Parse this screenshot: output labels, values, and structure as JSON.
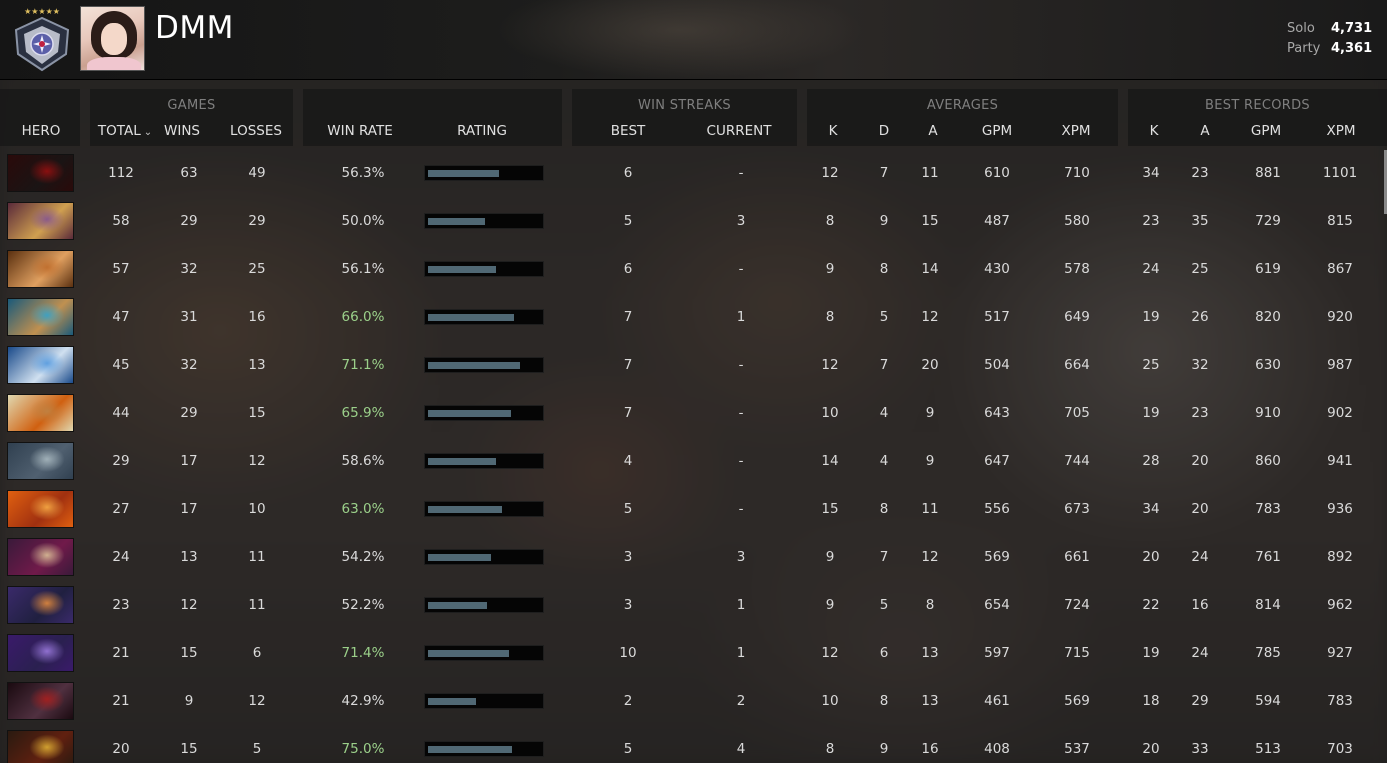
{
  "player": {
    "name": "DMM",
    "rank_medal": "medal-icon",
    "stars": "★★★★★"
  },
  "mmr": {
    "solo_label": "Solo",
    "solo_value": "4,731",
    "party_label": "Party",
    "party_value": "4,361"
  },
  "groups": {
    "games": "GAMES",
    "win_streaks": "WIN STREAKS",
    "averages": "AVERAGES",
    "best_records": "BEST RECORDS"
  },
  "columns": {
    "hero": "HERO",
    "total": "TOTAL",
    "wins": "WINS",
    "losses": "LOSSES",
    "win_rate": "WIN RATE",
    "rating": "RATING",
    "best": "BEST",
    "current": "CURRENT",
    "avg_k": "K",
    "avg_d": "D",
    "avg_a": "A",
    "avg_gpm": "GPM",
    "avg_xpm": "XPM",
    "rec_k": "K",
    "rec_a": "A",
    "rec_gpm": "GPM",
    "rec_xpm": "XPM"
  },
  "colors": {
    "win_rate_high": "#9bd08a",
    "rating_bar": "#506874"
  },
  "rows": [
    {
      "hero_icon": "shadow-fiend-icon",
      "hero_colors": [
        "#2a0a0a",
        "#8a1010",
        "#1a1414"
      ],
      "total": "112",
      "wins": "63",
      "losses": "49",
      "win_rate": "56.3%",
      "high": false,
      "rating": 0.62,
      "best": "6",
      "current": "-",
      "k": "12",
      "d": "7",
      "a": "11",
      "gpm": "610",
      "xpm": "710",
      "rk": "34",
      "ra": "23",
      "rgpm": "881",
      "rxpm": "1101"
    },
    {
      "hero_icon": "troll-warlord-icon",
      "hero_colors": [
        "#5a2a3a",
        "#8a5a8a",
        "#d0a050"
      ],
      "total": "58",
      "wins": "29",
      "losses": "29",
      "win_rate": "50.0%",
      "high": false,
      "rating": 0.5,
      "best": "5",
      "current": "3",
      "k": "8",
      "d": "9",
      "a": "15",
      "gpm": "487",
      "xpm": "580",
      "rk": "23",
      "ra": "35",
      "rgpm": "729",
      "rxpm": "815"
    },
    {
      "hero_icon": "brewmaster-icon",
      "hero_colors": [
        "#5a3010",
        "#c07030",
        "#e0a060"
      ],
      "total": "57",
      "wins": "32",
      "losses": "25",
      "win_rate": "56.1%",
      "high": false,
      "rating": 0.6,
      "best": "6",
      "current": "-",
      "k": "9",
      "d": "8",
      "a": "14",
      "gpm": "430",
      "xpm": "578",
      "rk": "24",
      "ra": "25",
      "rgpm": "619",
      "rxpm": "867"
    },
    {
      "hero_icon": "sniper-icon",
      "hero_colors": [
        "#1a5a7a",
        "#40a0c0",
        "#c09050"
      ],
      "total": "47",
      "wins": "31",
      "losses": "16",
      "win_rate": "66.0%",
      "high": true,
      "rating": 0.75,
      "best": "7",
      "current": "1",
      "k": "8",
      "d": "5",
      "a": "12",
      "gpm": "517",
      "xpm": "649",
      "rk": "19",
      "ra": "26",
      "rgpm": "820",
      "rxpm": "920"
    },
    {
      "hero_icon": "zeus-icon",
      "hero_colors": [
        "#1a4a8a",
        "#60a0e0",
        "#d0e0f0"
      ],
      "total": "45",
      "wins": "32",
      "losses": "13",
      "win_rate": "71.1%",
      "high": true,
      "rating": 0.81,
      "best": "7",
      "current": "-",
      "k": "12",
      "d": "7",
      "a": "20",
      "gpm": "504",
      "xpm": "664",
      "rk": "25",
      "ra": "32",
      "rgpm": "630",
      "rxpm": "987"
    },
    {
      "hero_icon": "mars-icon",
      "hero_colors": [
        "#e0d8b0",
        "#c08040",
        "#d06010"
      ],
      "total": "44",
      "wins": "29",
      "losses": "15",
      "win_rate": "65.9%",
      "high": true,
      "rating": 0.73,
      "best": "7",
      "current": "-",
      "k": "10",
      "d": "4",
      "a": "9",
      "gpm": "643",
      "xpm": "705",
      "rk": "19",
      "ra": "23",
      "rgpm": "910",
      "rxpm": "902"
    },
    {
      "hero_icon": "lancer-icon",
      "hero_colors": [
        "#304050",
        "#a0b0b8",
        "#506070"
      ],
      "total": "29",
      "wins": "17",
      "losses": "12",
      "win_rate": "58.6%",
      "high": false,
      "rating": 0.6,
      "best": "4",
      "current": "-",
      "k": "14",
      "d": "4",
      "a": "9",
      "gpm": "647",
      "xpm": "744",
      "rk": "28",
      "ra": "20",
      "rgpm": "860",
      "rxpm": "941"
    },
    {
      "hero_icon": "lina-icon",
      "hero_colors": [
        "#e06010",
        "#f0a040",
        "#a03010"
      ],
      "total": "27",
      "wins": "17",
      "losses": "10",
      "win_rate": "63.0%",
      "high": true,
      "rating": 0.65,
      "best": "5",
      "current": "-",
      "k": "15",
      "d": "8",
      "a": "11",
      "gpm": "556",
      "xpm": "673",
      "rk": "34",
      "ra": "20",
      "rgpm": "783",
      "rxpm": "936"
    },
    {
      "hero_icon": "invoker-icon",
      "hero_colors": [
        "#3a1a3a",
        "#d0b090",
        "#701a4a"
      ],
      "total": "24",
      "wins": "13",
      "losses": "11",
      "win_rate": "54.2%",
      "high": false,
      "rating": 0.55,
      "best": "3",
      "current": "3",
      "k": "9",
      "d": "7",
      "a": "12",
      "gpm": "569",
      "xpm": "661",
      "rk": "20",
      "ra": "24",
      "rgpm": "761",
      "rxpm": "892"
    },
    {
      "hero_icon": "anti-mage-icon",
      "hero_colors": [
        "#3a2a6a",
        "#d08040",
        "#202040"
      ],
      "total": "23",
      "wins": "12",
      "losses": "11",
      "win_rate": "52.2%",
      "high": false,
      "rating": 0.52,
      "best": "3",
      "current": "1",
      "k": "9",
      "d": "5",
      "a": "8",
      "gpm": "654",
      "xpm": "724",
      "rk": "22",
      "ra": "16",
      "rgpm": "814",
      "rxpm": "962"
    },
    {
      "hero_icon": "faceless-void-icon",
      "hero_colors": [
        "#3a1a6a",
        "#9070d0",
        "#2a2050"
      ],
      "total": "21",
      "wins": "15",
      "losses": "6",
      "win_rate": "71.4%",
      "high": true,
      "rating": 0.71,
      "best": "10",
      "current": "1",
      "k": "12",
      "d": "6",
      "a": "13",
      "gpm": "597",
      "xpm": "715",
      "rk": "19",
      "ra": "24",
      "rgpm": "785",
      "rxpm": "927"
    },
    {
      "hero_icon": "queen-of-pain-icon",
      "hero_colors": [
        "#1a0a10",
        "#a02020",
        "#503040"
      ],
      "total": "21",
      "wins": "9",
      "losses": "12",
      "win_rate": "42.9%",
      "high": false,
      "rating": 0.42,
      "best": "2",
      "current": "2",
      "k": "10",
      "d": "8",
      "a": "13",
      "gpm": "461",
      "xpm": "569",
      "rk": "18",
      "ra": "29",
      "rgpm": "594",
      "rxpm": "783"
    },
    {
      "hero_icon": "legion-commander-icon",
      "hero_colors": [
        "#2a1a10",
        "#d0a030",
        "#602010"
      ],
      "total": "20",
      "wins": "15",
      "losses": "5",
      "win_rate": "75.0%",
      "high": true,
      "rating": 0.74,
      "best": "5",
      "current": "4",
      "k": "8",
      "d": "9",
      "a": "16",
      "gpm": "408",
      "xpm": "537",
      "rk": "20",
      "ra": "33",
      "rgpm": "513",
      "rxpm": "703"
    }
  ]
}
